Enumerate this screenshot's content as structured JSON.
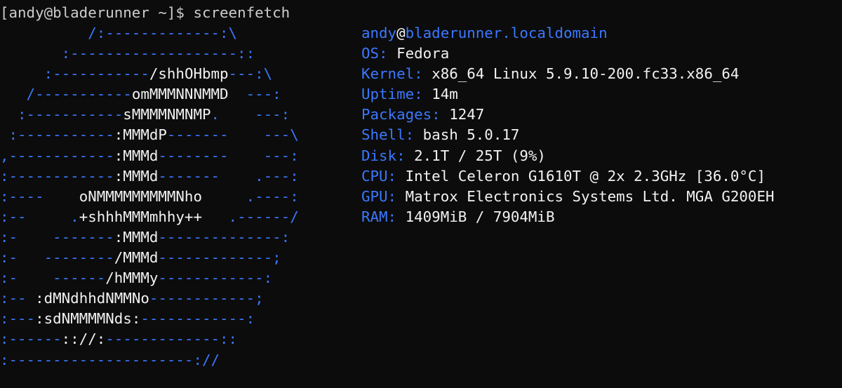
{
  "prompt": {
    "user_host": "[andy@bladerunner ~]$",
    "command": "screenfetch"
  },
  "logo_lines": [
    [
      [
        "b",
        "          /:-------------:\\"
      ]
    ],
    [
      [
        "b",
        "       :-------------------::"
      ]
    ],
    [
      [
        "b",
        "     :-----------"
      ],
      [
        "w",
        "/shhOHbmp"
      ],
      [
        "b",
        "---:\\"
      ]
    ],
    [
      [
        "b",
        "   /-----------"
      ],
      [
        "w",
        "omMMMNNNMMD"
      ],
      [
        "b",
        "  ---:"
      ]
    ],
    [
      [
        "b",
        "  :-----------"
      ],
      [
        "w",
        "sMMMMNMNMP"
      ],
      [
        "b",
        ".    ---:"
      ]
    ],
    [
      [
        "b",
        " :-----------"
      ],
      [
        "w",
        ":MMMdP"
      ],
      [
        "b",
        "-------    ---\\"
      ]
    ],
    [
      [
        "b",
        ",------------"
      ],
      [
        "w",
        ":MMMd"
      ],
      [
        "b",
        "--------    ---:"
      ]
    ],
    [
      [
        "b",
        ":------------"
      ],
      [
        "w",
        ":MMMd"
      ],
      [
        "b",
        "-------    .---:"
      ]
    ],
    [
      [
        "b",
        ":----    "
      ],
      [
        "w",
        "oNMMMMMMMMMNho"
      ],
      [
        "b",
        "     .----:"
      ]
    ],
    [
      [
        "b",
        ":--     ."
      ],
      [
        "w",
        "+shhhMMMmhhy++"
      ],
      [
        "b",
        "   .------/"
      ]
    ],
    [
      [
        "b",
        ":-    -------"
      ],
      [
        "w",
        ":MMMd"
      ],
      [
        "b",
        "--------------:"
      ]
    ],
    [
      [
        "b",
        ":-   --------"
      ],
      [
        "w",
        "/MMMd"
      ],
      [
        "b",
        "-------------;"
      ]
    ],
    [
      [
        "b",
        ":-    ------"
      ],
      [
        "w",
        "/hMMMy"
      ],
      [
        "b",
        "------------:"
      ]
    ],
    [
      [
        "b",
        ":-- "
      ],
      [
        "w",
        ":dMNdhhdNMMNo"
      ],
      [
        "b",
        "------------;"
      ]
    ],
    [
      [
        "b",
        ":---"
      ],
      [
        "w",
        ":sdNMMMMNds:"
      ],
      [
        "b",
        "------------:"
      ]
    ],
    [
      [
        "b",
        ":------"
      ],
      [
        "w",
        ":://:"
      ],
      [
        "b",
        "-------------::"
      ]
    ],
    [
      [
        "b",
        ":---------------------://"
      ]
    ]
  ],
  "info": {
    "user": "andy",
    "at": "@",
    "host": "bladerunner.localdomain",
    "rows": [
      {
        "label": "OS:",
        "value": "Fedora"
      },
      {
        "label": "Kernel:",
        "value": "x86_64 Linux 5.9.10-200.fc33.x86_64"
      },
      {
        "label": "Uptime:",
        "value": "14m"
      },
      {
        "label": "Packages:",
        "value": "1247"
      },
      {
        "label": "Shell:",
        "value": "bash 5.0.17"
      },
      {
        "label": "Disk:",
        "value": "2.1T / 25T (9%)"
      },
      {
        "label": "CPU:",
        "value": "Intel Celeron G1610T @ 2x 2.3GHz [36.0°C]"
      },
      {
        "label": "GPU:",
        "value": "Matrox Electronics Systems Ltd. MGA G200EH"
      },
      {
        "label": "RAM:",
        "value": "1409MiB / 7904MiB"
      }
    ]
  },
  "colors": {
    "background": "#0c0c0c",
    "text": "#cccccc",
    "accent_blue": "#3b78ff",
    "bright_white": "#f2f2f2"
  }
}
